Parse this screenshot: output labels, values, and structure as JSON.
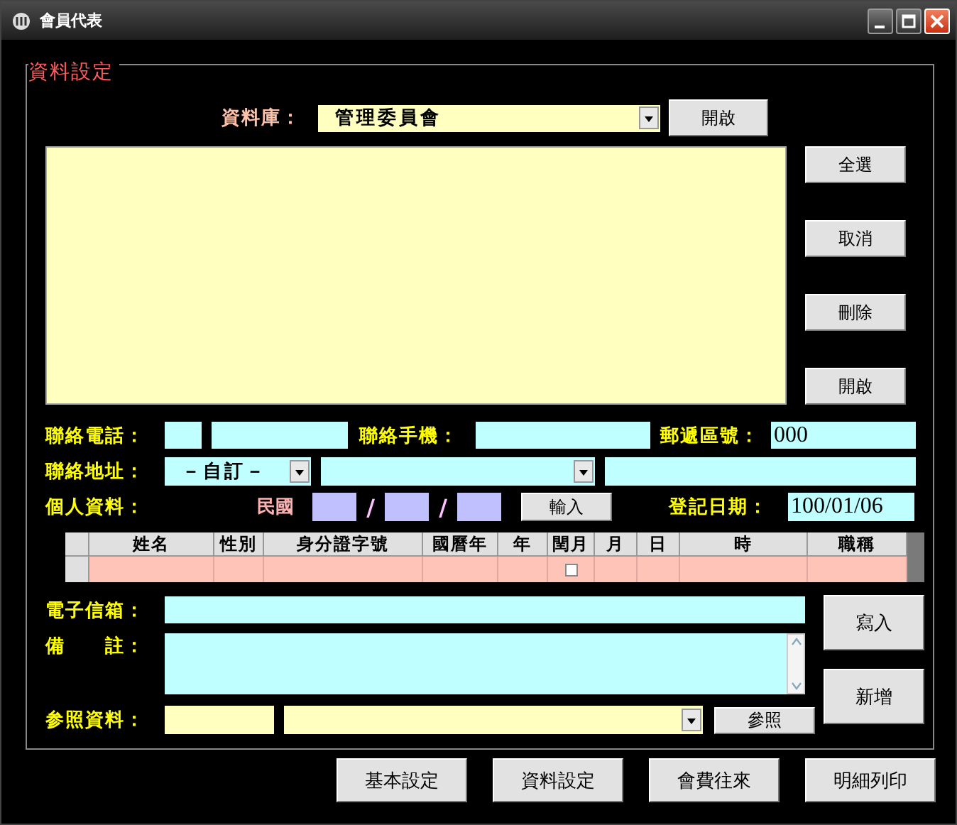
{
  "window": {
    "title": "會員代表"
  },
  "group": {
    "title": "資料設定"
  },
  "database": {
    "label": "資料庫：",
    "value": "管理委員會",
    "button": "開啟"
  },
  "list_buttons": [
    "全選",
    "取消",
    "刪除",
    "開啟"
  ],
  "contact": {
    "phone_label": "聯絡電話：",
    "mobile_label": "聯絡手機：",
    "zip_label": "郵遞區號：",
    "zip": "000",
    "address_label": "聯絡地址：",
    "address_type": "－自訂－"
  },
  "personal": {
    "label": "個人資料：",
    "era": "民國",
    "separators": [
      "/",
      "/"
    ],
    "enter_button": "輸入",
    "reg_date_label": "登記日期：",
    "reg_date": "100/01/06"
  },
  "table": {
    "columns": [
      {
        "label": "姓名",
        "kind": "text"
      },
      {
        "label": "性別",
        "kind": "text"
      },
      {
        "label": "身分證字號",
        "kind": "text"
      },
      {
        "label": "國曆年",
        "kind": "text"
      },
      {
        "label": "年",
        "kind": "text"
      },
      {
        "label": "閏月",
        "kind": "checkbox"
      },
      {
        "label": "月",
        "kind": "text"
      },
      {
        "label": "日",
        "kind": "text"
      },
      {
        "label": "時",
        "kind": "text"
      },
      {
        "label": "職稱",
        "kind": "text"
      }
    ],
    "rows": [
      {
        "checked": false
      }
    ]
  },
  "email_label": "電子信箱：",
  "note_label": "備　　註：",
  "reference": {
    "label": "参照資料：",
    "button": "參照"
  },
  "side_buttons": [
    "寫入",
    "新增"
  ],
  "nav_buttons": [
    "基本設定",
    "資料設定",
    "會費往來",
    "明細列印"
  ]
}
